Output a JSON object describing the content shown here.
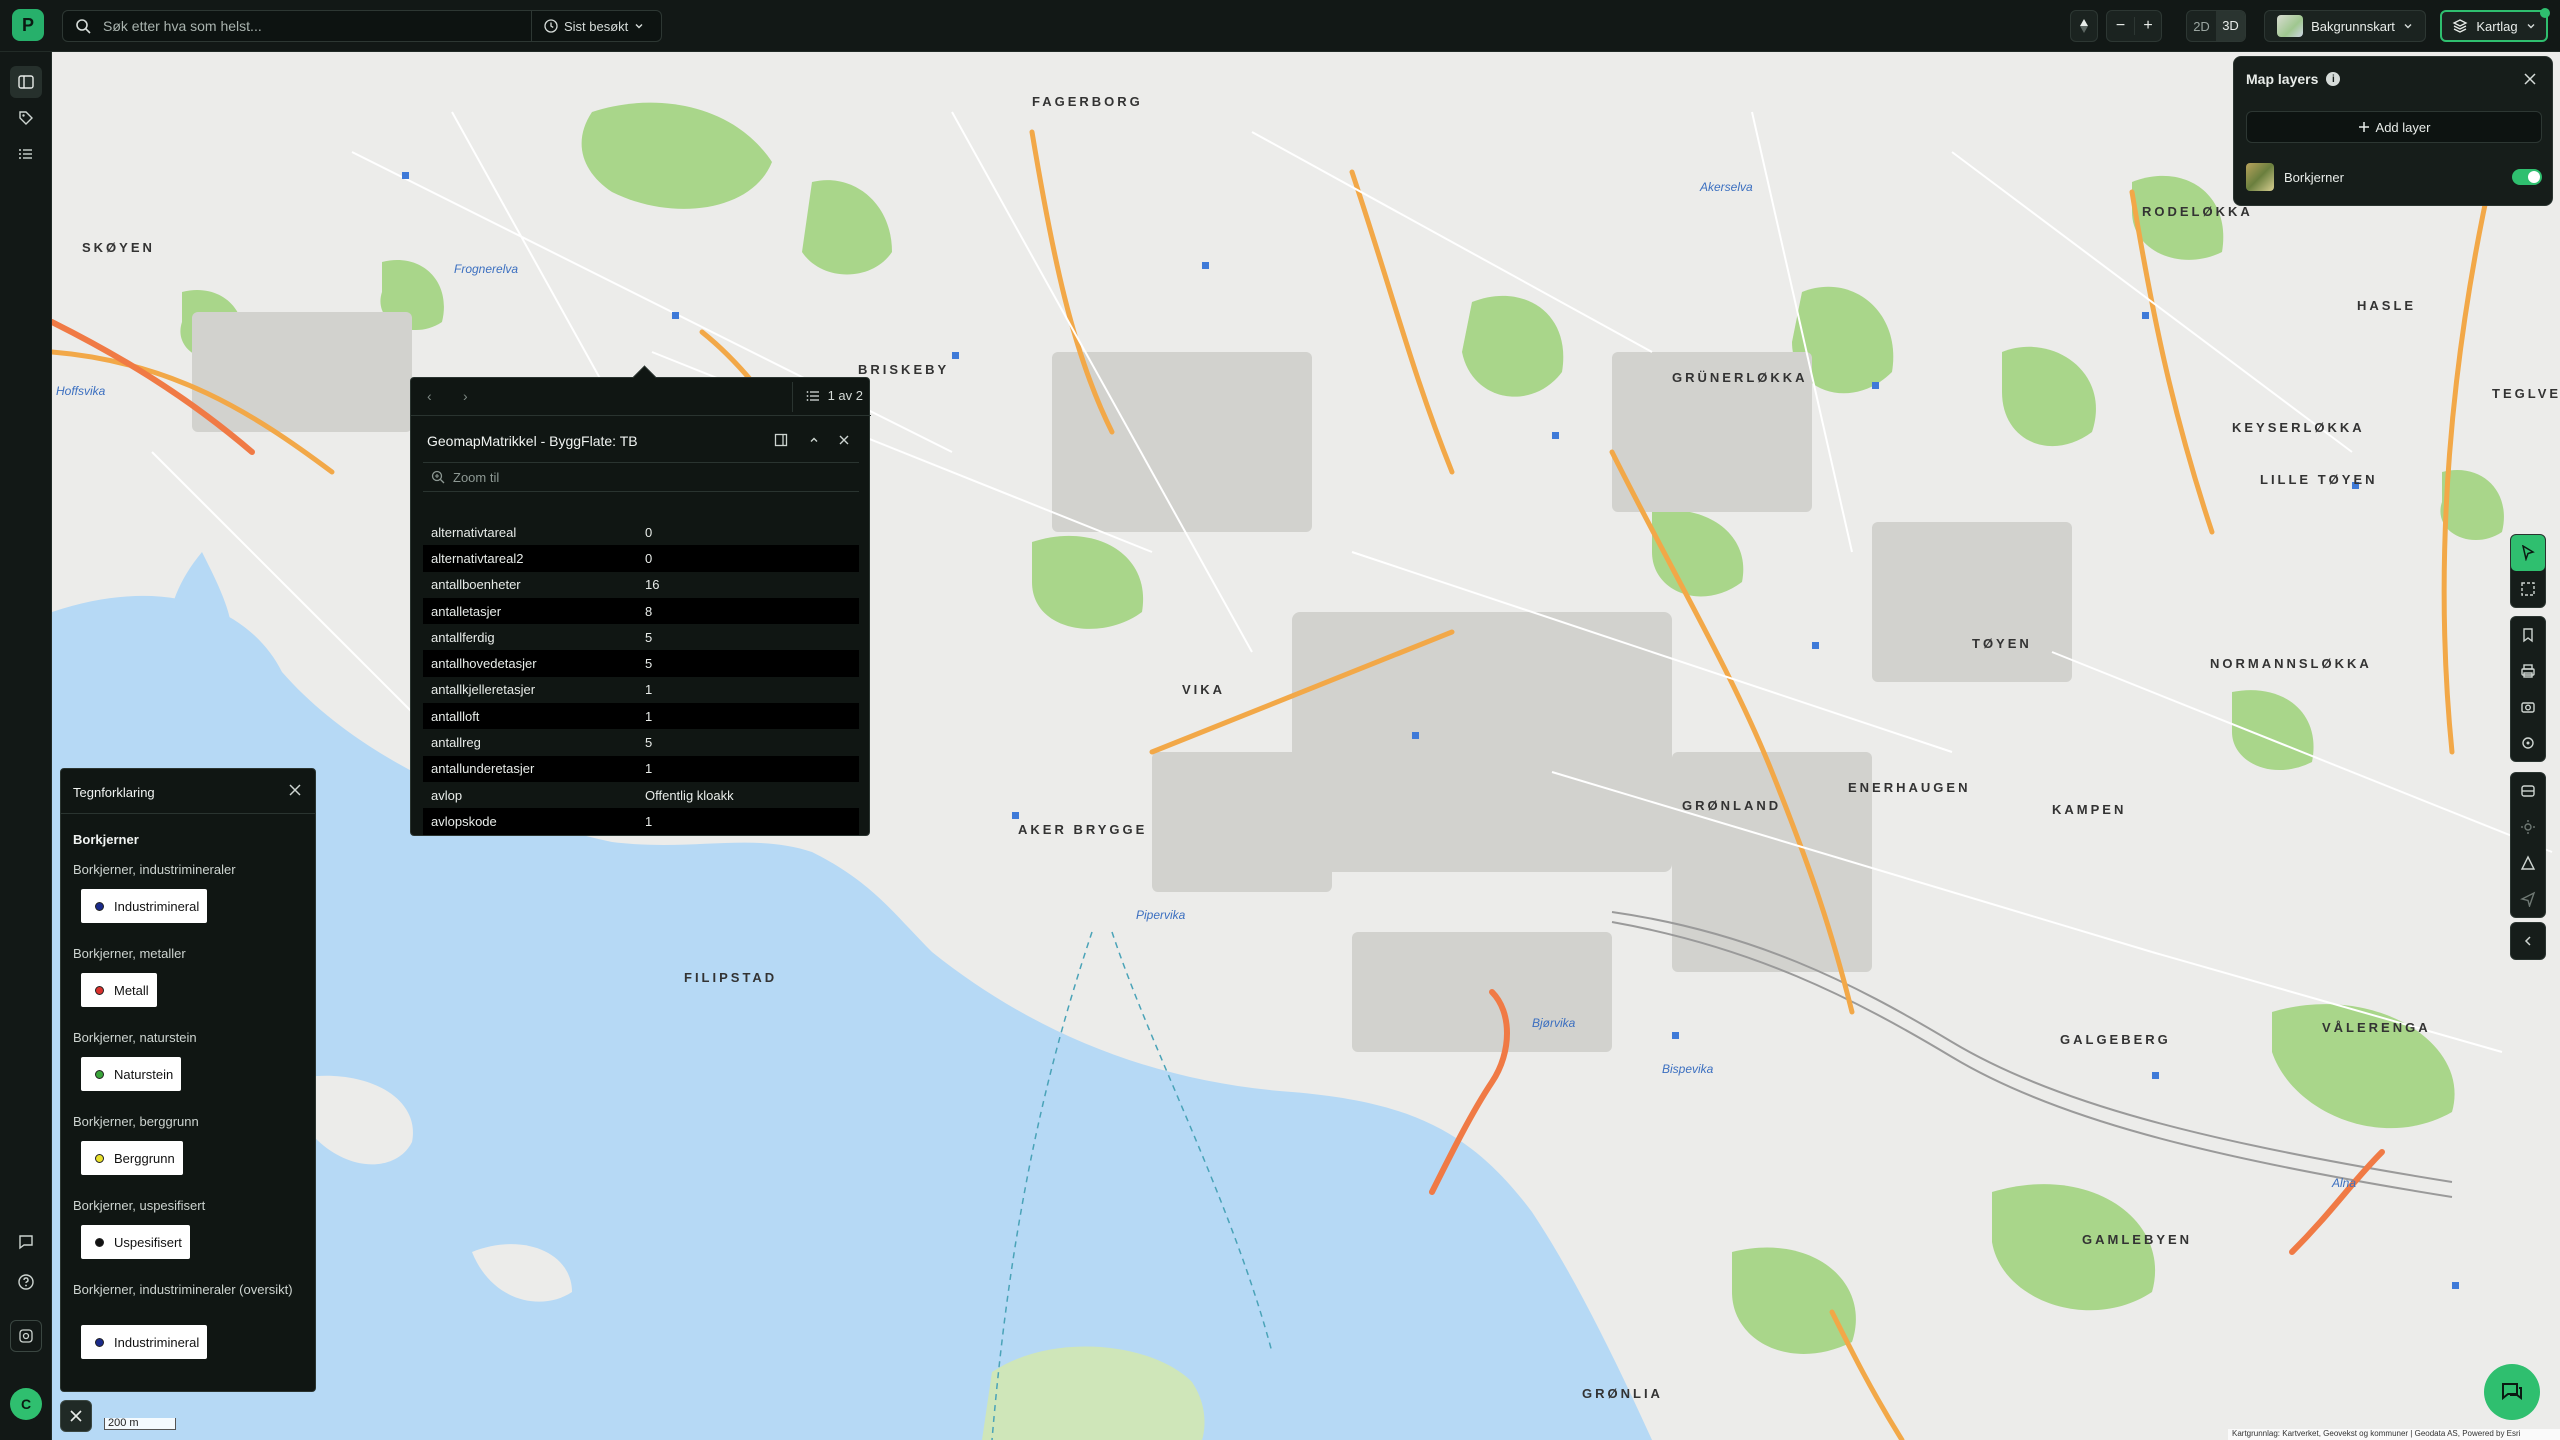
{
  "search": {
    "placeholder": "Søk etter hva som helst...",
    "recent_label": "Sist besøkt"
  },
  "toolbar": {
    "mode_2d": "2D",
    "mode_3d": "3D",
    "zoom_out": "−",
    "zoom_in": "+",
    "basemap_label": "Bakgrunnskart",
    "layers_label": "Kartlag"
  },
  "user": {
    "initial": "C"
  },
  "map_layers": {
    "title": "Map layers",
    "add_label": "Add layer",
    "layers": [
      {
        "name": "Borkjerner",
        "visible": true
      }
    ]
  },
  "popup": {
    "counter": "1 av 2",
    "title": "GeomapMatrikkel - ByggFlate: TB",
    "zoom_label": "Zoom til",
    "rows": [
      {
        "key": "alternativtareal",
        "value": "0"
      },
      {
        "key": "alternativtareal2",
        "value": "0"
      },
      {
        "key": "antallboenheter",
        "value": "16"
      },
      {
        "key": "antalletasjer",
        "value": "8"
      },
      {
        "key": "antallferdig",
        "value": "5"
      },
      {
        "key": "antallhovedetasjer",
        "value": "5"
      },
      {
        "key": "antallkjelleretasjer",
        "value": "1"
      },
      {
        "key": "antallloft",
        "value": "1"
      },
      {
        "key": "antallreg",
        "value": "5"
      },
      {
        "key": "antallunderetasjer",
        "value": "1"
      },
      {
        "key": "avlop",
        "value": "Offentlig kloakk"
      },
      {
        "key": "avlopskode",
        "value": "1"
      }
    ]
  },
  "legend": {
    "title": "Tegnforklaring",
    "group": "Borkjerner",
    "sections": [
      {
        "title": "Borkjerner, industrimineraler",
        "item": "Industrimineral",
        "color": "#1a2a8a"
      },
      {
        "title": "Borkjerner, metaller",
        "item": "Metall",
        "color": "#d9302c"
      },
      {
        "title": "Borkjerner, naturstein",
        "item": "Naturstein",
        "color": "#3aa43a"
      },
      {
        "title": "Borkjerner, berggrunn",
        "item": "Berggrunn",
        "color": "#e8e02a"
      },
      {
        "title": "Borkjerner, uspesifisert",
        "item": "Uspesifisert",
        "color": "#111111"
      },
      {
        "title": "Borkjerner, industrimineraler (oversikt)",
        "item": "Industrimineral",
        "color": "#1a2a8a"
      }
    ]
  },
  "map": {
    "scale_label": "200 m",
    "attribution": "Kartgrunnlag: Kartverket, Geovekst og kommuner | Geodata AS, Powered by Esri",
    "places": [
      "FAGERBORG",
      "RODELØKKA",
      "GRÜNERLØKKA",
      "SKØYEN",
      "BRISKEBY",
      "KEYSERLØKKA",
      "LILLE TØYEN",
      "TØYEN",
      "NORMANNSLØKKA",
      "GRØNLAND",
      "ENERHAUGEN",
      "KAMPEN",
      "AKER BRYGGE",
      "VIKA",
      "FILIPSTAD",
      "GALGEBERG",
      "VÅLERENGA",
      "GAMLEBYEN",
      "GRØNLIA",
      "HASLE",
      "TEGLVERKET"
    ],
    "water_labels": [
      "Frognerelva",
      "Akerselva",
      "Pipervika",
      "Bjørvika",
      "Hoffsvika",
      "Alna",
      "Bispevika"
    ]
  }
}
